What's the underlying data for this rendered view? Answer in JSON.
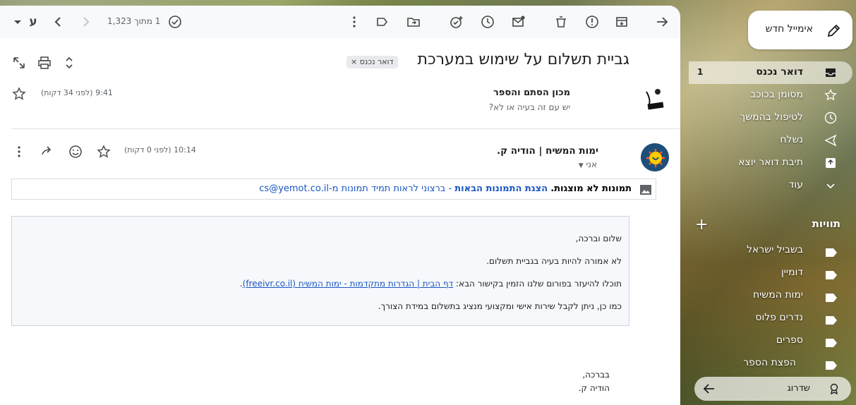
{
  "toolbar": {
    "pager": "1 מתוך 1,323",
    "lang_button": "ע"
  },
  "email": {
    "subject": "גביית תשלום על שימוש במערכת",
    "label_chip": "דואר נכנס ×",
    "first_message": {
      "sender": "מכון הסתם והספר",
      "snippet": "יש עם זה בעיה או לא?",
      "time": "9:41 (לפני 34 דקות)"
    },
    "second_message": {
      "sender": "ימות המשיח | הודיה ק.",
      "to": "אני",
      "time": "10:14 (לפני 0 דקות)"
    },
    "images_bar": {
      "not_shown": "תמונות לא מוצגות.",
      "show_link": "הצגת התמונות הבאות",
      "always_text": "- ברצוני לראות תמיד תמונות מ-cs@yemot.co.il"
    },
    "body": {
      "greeting": "שלום וברכה,",
      "line1": "לא אמורה להיות בעיה בגביית תשלום.",
      "line2_prefix": "תוכלו להיעזר בפורום שלנו הזמין בקישור הבא:",
      "line2_link": "דף הבית | הגדרות מתקדמות - ימות המשיח (freeivr.co.il)",
      "line2_suffix": ".",
      "line3": "כמו כן, ניתן לקבל שירות אישי ומקצועי מנציג בתשלום במידת הצורך.",
      "signoff": "בברכה,",
      "signature": "הודיה ק."
    }
  },
  "sidebar": {
    "compose_label": "אימייל חדש",
    "nav": [
      {
        "label": "דואר נכנס",
        "count": "1",
        "icon": "inbox-icon"
      },
      {
        "label": "מסומן בכוכב",
        "icon": "star-icon"
      },
      {
        "label": "לטיפול בהמשך",
        "icon": "clock-icon"
      },
      {
        "label": "נשלח",
        "icon": "send-icon"
      },
      {
        "label": "תיבת דואר יוצא",
        "icon": "outbox-icon"
      },
      {
        "label": "עוד",
        "icon": "chevron-down-icon"
      }
    ],
    "labels_title": "תוויות",
    "labels": [
      "בשביל ישראל",
      "דומיין",
      "ימות המשיח",
      "נדרים פלוס",
      "ספרים",
      "הפצת הספר"
    ],
    "upgrade_label": "שדרוג"
  }
}
